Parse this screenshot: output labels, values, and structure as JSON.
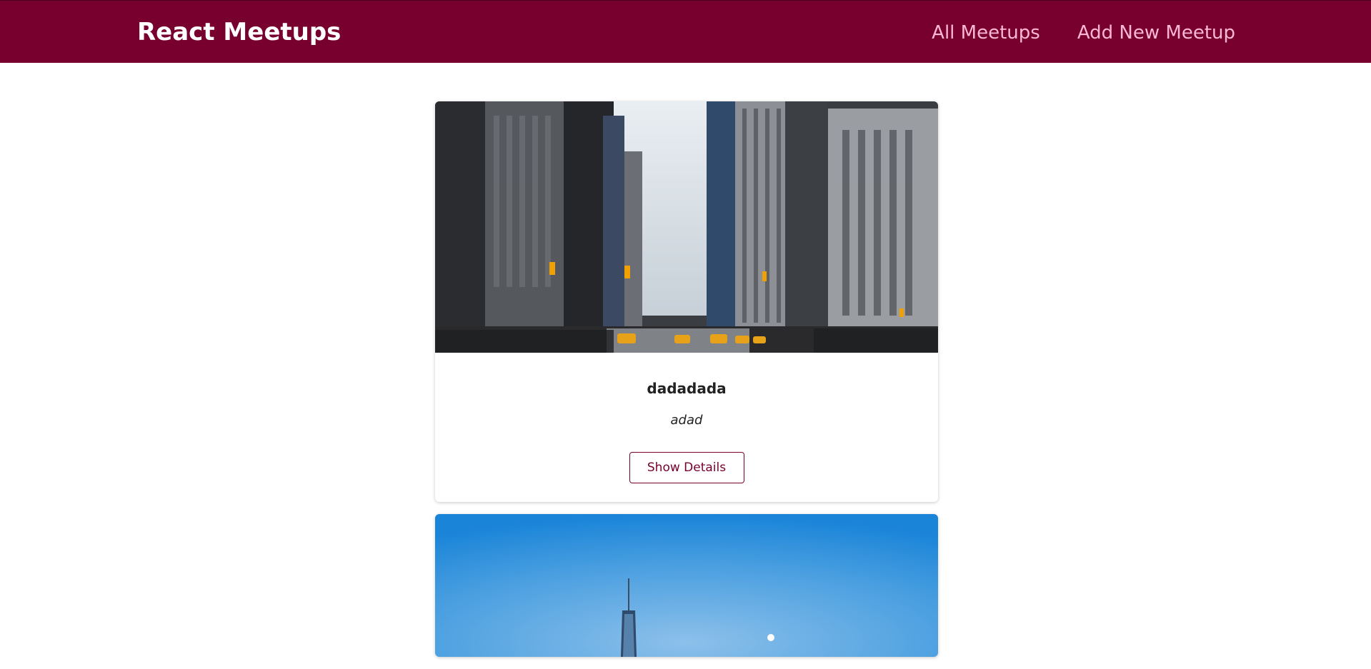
{
  "header": {
    "logo": "React Meetups",
    "nav": [
      {
        "label": "All Meetups"
      },
      {
        "label": "Add New Meetup"
      }
    ]
  },
  "meetups": [
    {
      "title": "dadadada",
      "address": "adad",
      "action_label": "Show Details",
      "image": "city-street-photo"
    },
    {
      "image": "tower-sky-photo"
    }
  ],
  "colors": {
    "brand": "#77002e",
    "nav_link": "#fcb8d2",
    "sky": "#2f8fd8"
  }
}
